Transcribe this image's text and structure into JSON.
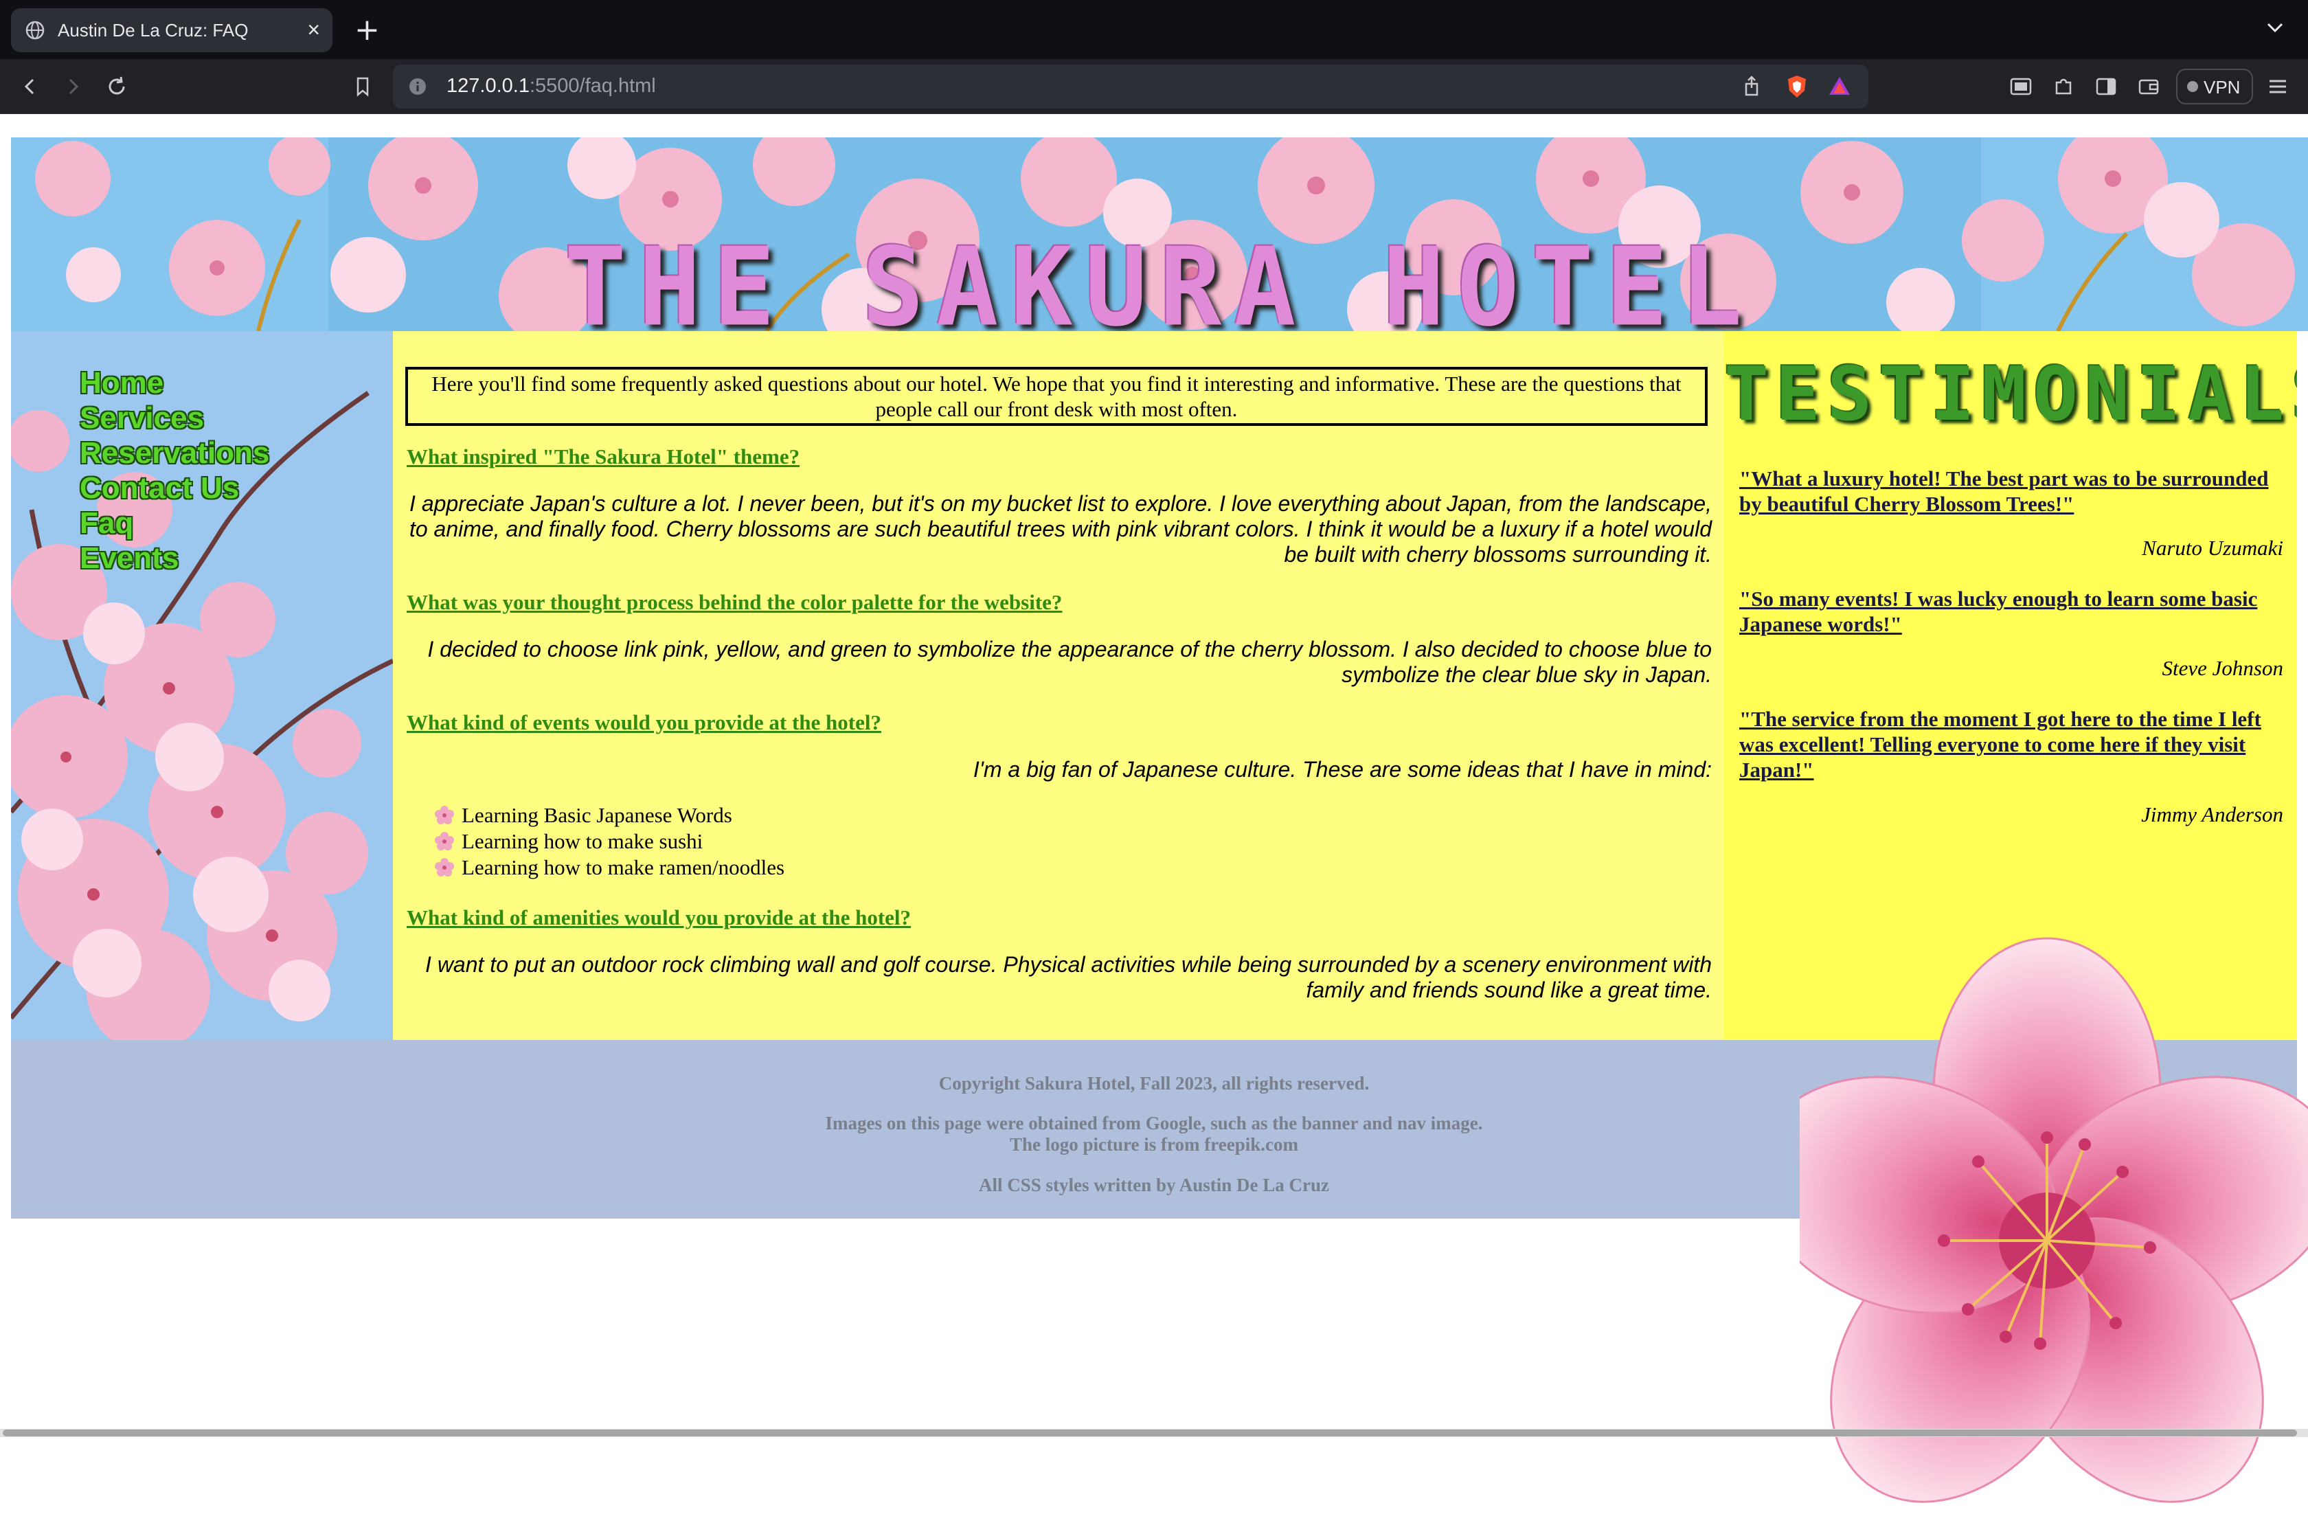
{
  "browser": {
    "tab_title": "Austin De La Cruz: FAQ",
    "url_host": "127.0.0.1",
    "url_rest": ":5500/faq.html",
    "vpn_label": "VPN"
  },
  "banner": {
    "logo_text": "THE SAKURA HOTEL"
  },
  "nav": {
    "items": [
      {
        "label": "Home"
      },
      {
        "label": "Services"
      },
      {
        "label": "Reservations"
      },
      {
        "label": "Contact Us"
      },
      {
        "label": "Faq"
      },
      {
        "label": "Events"
      }
    ]
  },
  "main": {
    "intro": "Here you'll find some frequently asked questions about our hotel. We hope that you find it interesting and informative. These are the questions that people call our front desk with most often.",
    "faqs": [
      {
        "question": "What inspired \"The Sakura Hotel\" theme?",
        "answer": "I appreciate Japan's culture a lot. I never been, but it's on my bucket list to explore. I love everything about Japan, from the landscape, to anime, and finally food. Cherry blossoms are such beautiful trees with pink vibrant colors. I think it would be a luxury if a hotel would be built with cherry blossoms surrounding it."
      },
      {
        "question": "What was your thought process behind the color palette for the website?",
        "answer": "I decided to choose link pink, yellow, and green to symbolize the appearance of the cherry blossom. I also decided to choose blue to symbolize the clear blue sky in Japan."
      },
      {
        "question": "What kind of events would you provide at the hotel?",
        "answer": "I'm a big fan of Japanese culture. These are some ideas that I have in mind:"
      },
      {
        "question": "What kind of amenities would you provide at the hotel?",
        "answer": "I want to put an outdoor rock climbing wall and golf course. Physical activities while being surrounded by a scenery environment with family and friends sound like a great time."
      }
    ],
    "event_ideas": [
      "Learning Basic Japanese Words",
      "Learning how to make sushi",
      "Learning how to make ramen/noodles"
    ]
  },
  "testimonials": {
    "title": "TESTIMONIALS",
    "items": [
      {
        "quote": "\"What a luxury hotel! The best part was to be surrounded by beautiful Cherry Blossom Trees!\"",
        "author": "Naruto Uzumaki"
      },
      {
        "quote": "\"So many events! I was lucky enough to learn some basic Japanese words!\"",
        "author": "Steve Johnson"
      },
      {
        "quote": "\"The service from the moment I got here to the time I left was excellent! Telling everyone to come here if they visit Japan!\"",
        "author": "Jimmy Anderson"
      }
    ]
  },
  "footer": {
    "copyright": "Copyright Sakura Hotel, Fall 2023, all rights reserved.",
    "images_credit": "Images on this page were obtained from Google, such as the banner and nav image.",
    "logo_credit": "The logo picture is from freepik.com",
    "css_credit": "All CSS styles written by Austin De La Cruz"
  },
  "colors": {
    "main_bg": "#fdfd81",
    "side_bg": "#ffff55",
    "footer_bg": "#b0c0dc",
    "link_green": "#2f8b12",
    "logo_pink": "#e08ad8"
  }
}
